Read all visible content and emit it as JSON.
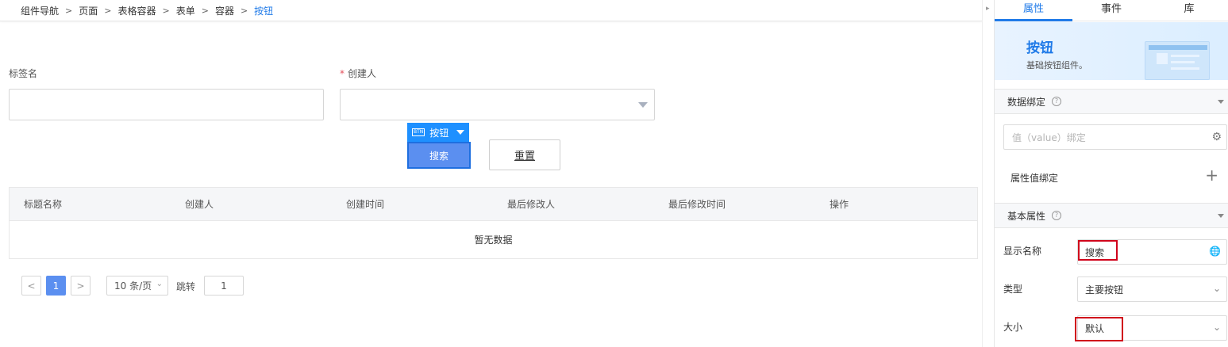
{
  "breadcrumb": [
    "组件导航",
    "页面",
    "表格容器",
    "表单",
    "容器",
    "按钮"
  ],
  "form": {
    "tag_label": "标签名",
    "creator_label": "创建人",
    "required_mark": "*",
    "component_tag": "按钮",
    "component_tag_glyph": "BTN",
    "search_button": "搜索",
    "reset_button": "重置"
  },
  "table": {
    "columns": [
      "标题名称",
      "创建人",
      "创建时间",
      "最后修改人",
      "最后修改时间",
      "操作"
    ],
    "empty_text": "暂无数据"
  },
  "pagination": {
    "prev": "<",
    "current_page": "1",
    "next": ">",
    "page_size": "10 条/页",
    "jump_label": "跳转",
    "jump_value": "1"
  },
  "panel": {
    "tabs": [
      "属性",
      "事件",
      "库"
    ],
    "hero_title": "按钮",
    "hero_desc": "基础按钮组件。",
    "data_binding_title": "数据绑定",
    "value_binding_placeholder": "值（value）绑定",
    "prop_binding_label": "属性值绑定",
    "basic_props_title": "基本属性",
    "display_name_label": "显示名称",
    "display_name_value": "搜索",
    "type_label": "类型",
    "type_value": "主要按钮",
    "size_label": "大小",
    "size_value": "默认"
  },
  "colors": {
    "accent": "#1f7ae8",
    "button_primary": "#5b8ff0",
    "highlight_box": "#d0021b"
  },
  "icons": [
    "chevron-right-icon",
    "select-caret-icon",
    "btn-glyph-icon",
    "help-icon",
    "gear-icon",
    "plus-icon",
    "globe-icon",
    "chevron-down-icon"
  ]
}
